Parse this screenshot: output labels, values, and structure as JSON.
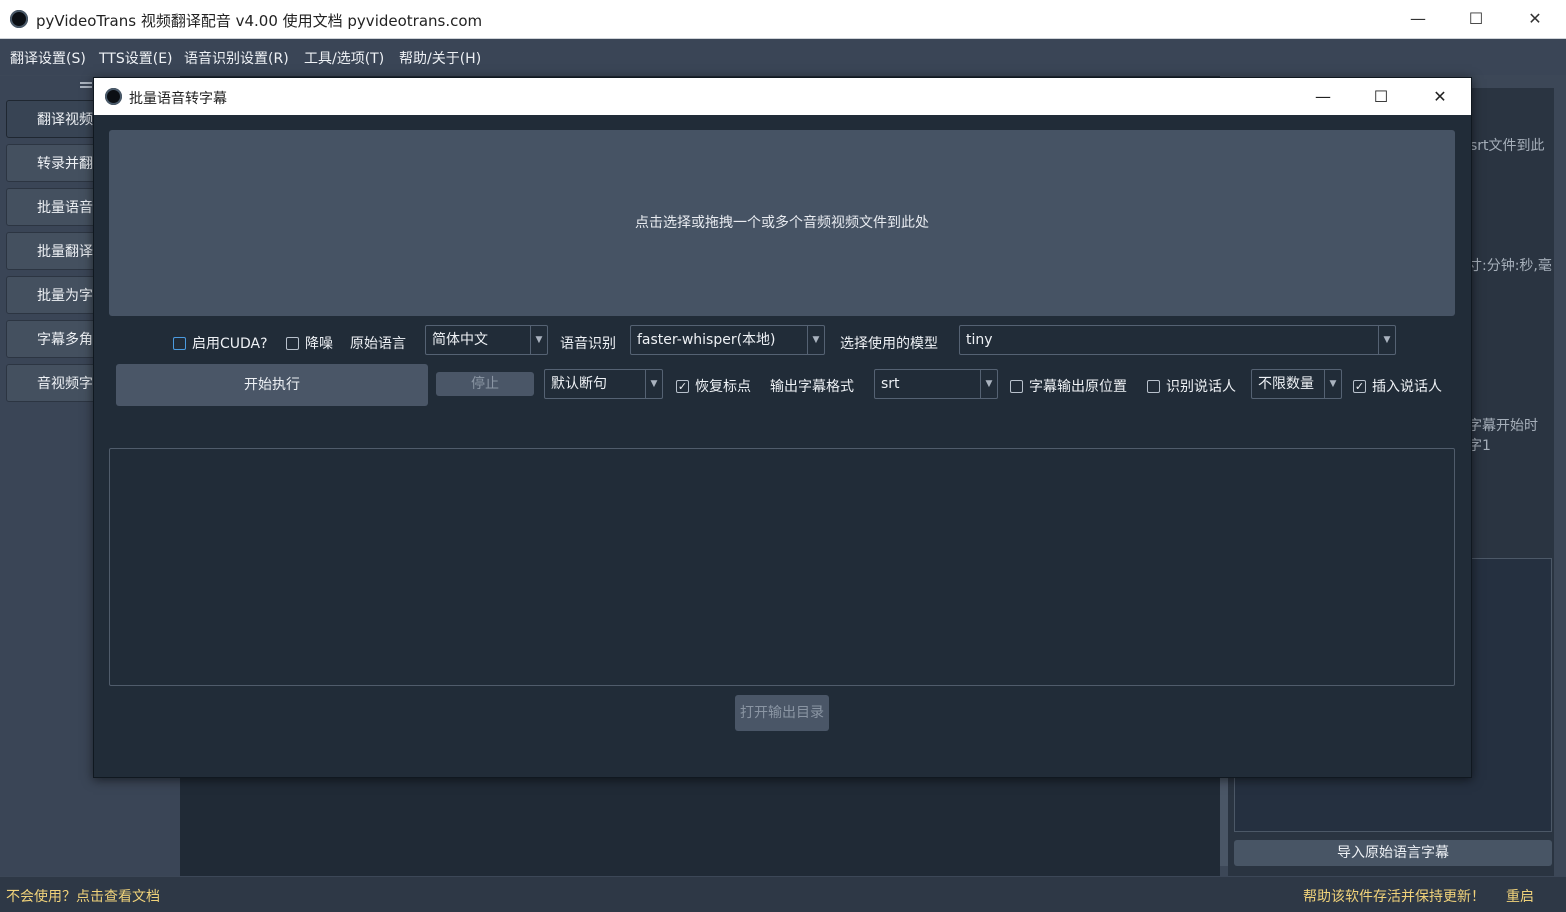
{
  "window": {
    "title": "pyVideoTrans 视频翻译配音 v4.00 使用文档 pyvideotrans.com",
    "minimize": "—",
    "maximize": "☐",
    "close": "✕"
  },
  "menu": [
    "翻译设置(S)",
    "TTS设置(E)",
    "语音识别设置(R)",
    "工具/选项(T)",
    "帮助/关于(H)"
  ],
  "sidebar": {
    "items": [
      "翻译视频",
      "转录并翻",
      "批量语音",
      "批量翻译",
      "批量为字",
      "字幕多角",
      "音视频字"
    ]
  },
  "background": {
    "hint1": "srt文件到此",
    "hint2": "寸:分钟:秒,毫",
    "hint3": "字幕开始时",
    "hint4": "字1",
    "import_button": "导入原始语言字幕"
  },
  "status": {
    "left": "不会使用？点击查看文档",
    "help": "帮助该软件存活并保持更新！",
    "restart": "重启"
  },
  "dialog": {
    "title": "批量语音转字幕",
    "dropzone": "点击选择或拖拽一个或多个音频视频文件到此处",
    "cuda_label": "启用CUDA?",
    "denoise_label": "降噪",
    "source_lang_label": "原始语言",
    "source_lang_value": "简体中文",
    "asr_label": "语音识别",
    "asr_value": "faster-whisper(本地)",
    "model_label": "选择使用的模型",
    "model_value": "tiny",
    "start_button": "开始执行",
    "stop_button": "停止",
    "split_value": "默认断句",
    "restore_punct_label": "恢复标点",
    "restore_punct_checked": true,
    "format_label": "输出字幕格式",
    "format_value": "srt",
    "orig_pos_label": "字幕输出原位置",
    "speaker_label": "识别说话人",
    "speaker_count_value": "不限数量",
    "insert_speaker_label": "插入说话人",
    "insert_speaker_checked": true,
    "open_output_button": "打开输出目录",
    "check_mark": "✓",
    "dropdown_arrow": "▼"
  }
}
